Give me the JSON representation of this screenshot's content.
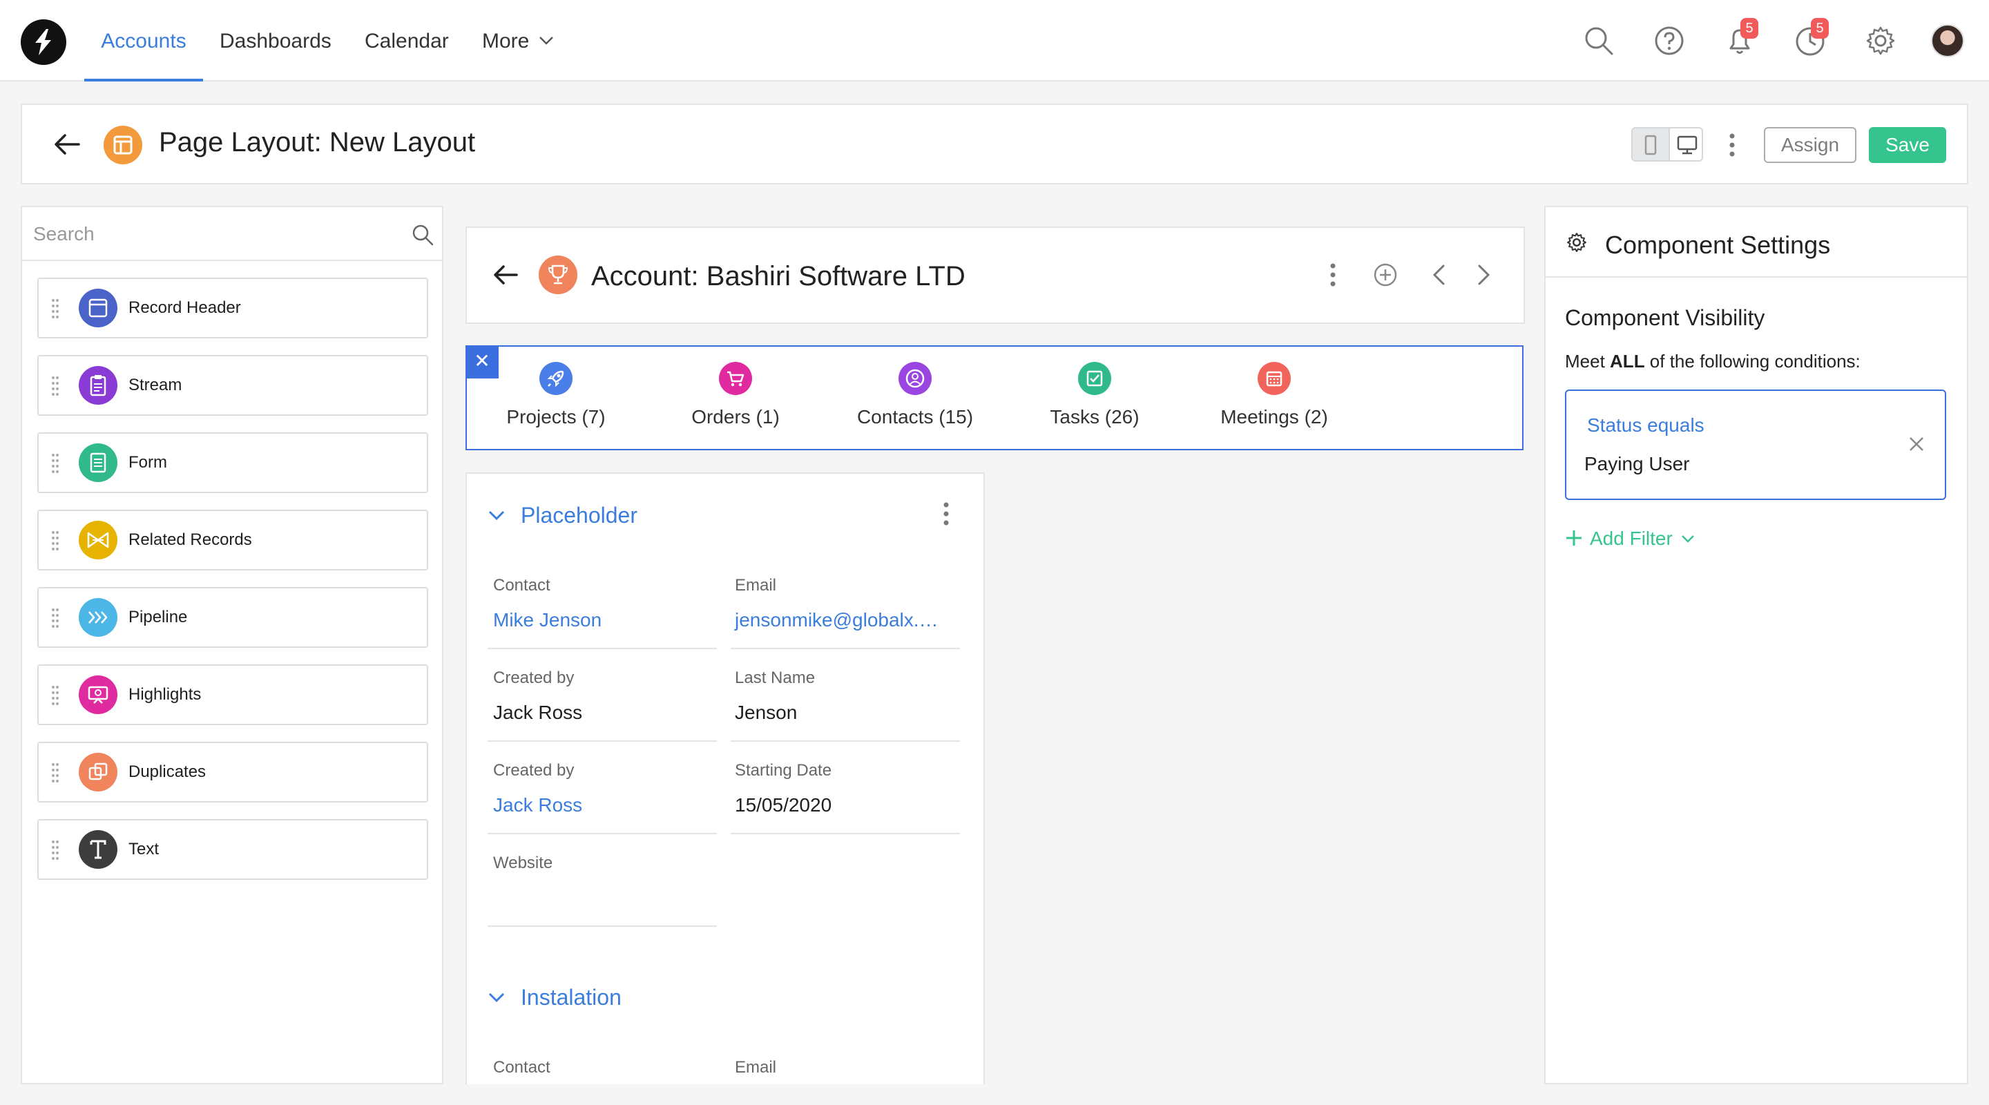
{
  "nav": {
    "tabs": [
      {
        "label": "Accounts",
        "active": true
      },
      {
        "label": "Dashboards"
      },
      {
        "label": "Calendar"
      },
      {
        "label": "More"
      }
    ],
    "icons": [
      "search-icon",
      "help-icon",
      "bell-icon",
      "clock-icon",
      "gear-icon",
      "avatar"
    ],
    "notification_count": "5",
    "activity_count": "5"
  },
  "page": {
    "title": "Page Layout: New Layout",
    "assign_label": "Assign",
    "save_label": "Save"
  },
  "left": {
    "search_placeholder": "Search",
    "components": [
      {
        "label": "Record Header",
        "color": "#4a63c8",
        "icon": "window-icon"
      },
      {
        "label": "Stream",
        "color": "#8a3bd6",
        "icon": "clipboard-icon"
      },
      {
        "label": "Form",
        "color": "#30b98a",
        "icon": "document-icon"
      },
      {
        "label": "Related Records",
        "color": "#e6b400",
        "icon": "bowtie-icon"
      },
      {
        "label": "Pipeline",
        "color": "#4cb7e6",
        "icon": "chevrons-icon"
      },
      {
        "label": "Highlights",
        "color": "#e02aa0",
        "icon": "presentation-icon"
      },
      {
        "label": "Duplicates",
        "color": "#f0845c",
        "icon": "duplicate-icon"
      },
      {
        "label": "Text",
        "color": "#3d3d3d",
        "icon": "text-icon"
      }
    ]
  },
  "record": {
    "title": "Account: Bashiri Software LTD",
    "related": [
      {
        "label": "Projects (7)",
        "color": "#4a7ee8",
        "icon": "rocket-icon"
      },
      {
        "label": "Orders (1)",
        "color": "#e02aa0",
        "icon": "cart-icon"
      },
      {
        "label": "Contacts (15)",
        "color": "#9b45e0",
        "icon": "user-icon"
      },
      {
        "label": "Tasks (26)",
        "color": "#30b98a",
        "icon": "checkbox-icon"
      },
      {
        "label": "Meetings (2)",
        "color": "#f0645c",
        "icon": "calendar-icon"
      }
    ],
    "section1": {
      "title": "Placeholder",
      "fields": [
        {
          "label": "Contact",
          "value": "Mike Jenson",
          "link": true
        },
        {
          "label": "Email",
          "value": "jensonmike@globalx.…",
          "link": true
        },
        {
          "label": "Created by",
          "value": "Jack Ross",
          "link": false
        },
        {
          "label": "Last Name",
          "value": "Jenson",
          "link": false
        },
        {
          "label": "Created by",
          "value": "Jack Ross",
          "link": true
        },
        {
          "label": "Starting Date",
          "value": "15/05/2020",
          "link": false
        },
        {
          "label": "Website",
          "value": "",
          "link": false
        }
      ]
    },
    "section2": {
      "title": "Instalation",
      "fields": [
        {
          "label": "Contact"
        },
        {
          "label": "Email"
        }
      ]
    }
  },
  "settings": {
    "title": "Component Settings",
    "visibility_title": "Component Visibility",
    "desc_pre": "Meet ",
    "desc_bold": "ALL",
    "desc_post": " of the following conditions:",
    "filter_field": "Status equals",
    "filter_value": "Paying User",
    "add_filter_label": "Add Filter"
  },
  "colors": {
    "accent": "#3b7ddd",
    "save": "#35c48d",
    "selection": "#3b6fe0",
    "badge": "#f25a5a"
  }
}
